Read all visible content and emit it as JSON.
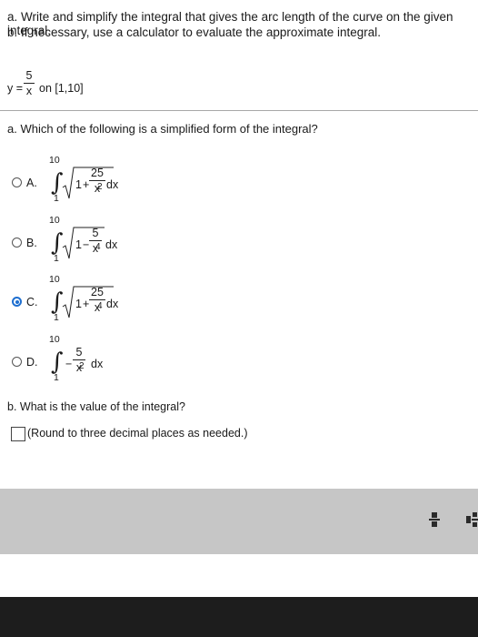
{
  "problem": {
    "line_a": "a. Write and simplify the integral that gives the arc length of the curve on the given integral.",
    "line_b": "b. If necessary, use a calculator to evaluate the approximate integral.",
    "equation": {
      "lhs": "y =",
      "num": "5",
      "den": "x",
      "interval": "on [1,10]"
    }
  },
  "part_a": {
    "prompt": "a. Which of the following is a simplified form of the integral?",
    "options": [
      {
        "letter": "A.",
        "selected": false,
        "upper": "10",
        "lower": "1",
        "one": "1",
        "op": "+",
        "num": "25",
        "den": "x",
        "exp": "2",
        "dx": "dx"
      },
      {
        "letter": "B.",
        "selected": false,
        "upper": "10",
        "lower": "1",
        "one": "1",
        "op": "−",
        "num": "5",
        "den": "x",
        "exp": "4",
        "dx": "dx"
      },
      {
        "letter": "C.",
        "selected": true,
        "upper": "10",
        "lower": "1",
        "one": "1",
        "op": "+",
        "num": "25",
        "den": "x",
        "exp": "4",
        "dx": "dx"
      },
      {
        "letter": "D.",
        "selected": false,
        "upper": "10",
        "lower": "1",
        "op": "−",
        "num": "5",
        "den": "x",
        "exp": "2",
        "dx": "dx"
      }
    ]
  },
  "part_b": {
    "prompt": "b. What is the value of the integral?",
    "hint": "(Round to three decimal places as needed.)"
  },
  "toolbar": {
    "icons": [
      "fraction-icon",
      "mixed-number-icon"
    ]
  },
  "colors": {
    "selected_radio": "#1e6fd0",
    "toolbar_bg": "#c6c6c6",
    "bottom_bar": "#1d1d1d"
  }
}
